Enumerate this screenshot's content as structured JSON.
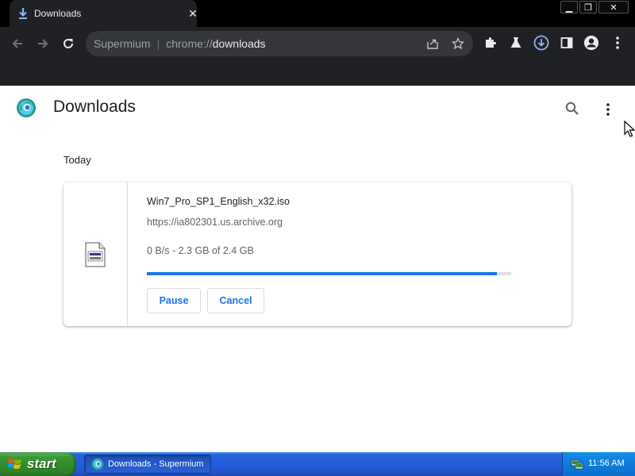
{
  "browser": {
    "tab": {
      "title": "Downloads",
      "icon": "download-icon",
      "close": "✕"
    },
    "window_controls": {
      "minimize": "▁",
      "restore": "❐",
      "close": "✕"
    },
    "omnibox": {
      "brand": "Supermium",
      "separator": "|",
      "scheme": "chrome://",
      "path": "downloads"
    },
    "toolbar_icons": [
      "back-icon",
      "forward-icon",
      "reload-icon",
      "share-icon",
      "bookmark-star-icon",
      "extensions-icon",
      "labs-icon",
      "downloads-icon",
      "side-panel-icon",
      "profile-icon",
      "menu-icon"
    ]
  },
  "page": {
    "title": "Downloads",
    "date_heading": "Today",
    "download": {
      "file_name": "Win7_Pro_SP1_English_x32.iso",
      "url": "https://ia802301.us.archive.org",
      "status": "0 B/s - 2.3 GB of 2.4 GB",
      "progress_fraction": 0.96,
      "pause_label": "Pause",
      "cancel_label": "Cancel"
    }
  },
  "taskbar": {
    "start_label": "start",
    "task_label": "Downloads - Supermium",
    "clock": "11:56 AM"
  },
  "colors": {
    "accent": "#1a73e8",
    "browser_chrome": "#202124",
    "taskbar_blue": "#245ddb",
    "start_green": "#3c9a36"
  }
}
